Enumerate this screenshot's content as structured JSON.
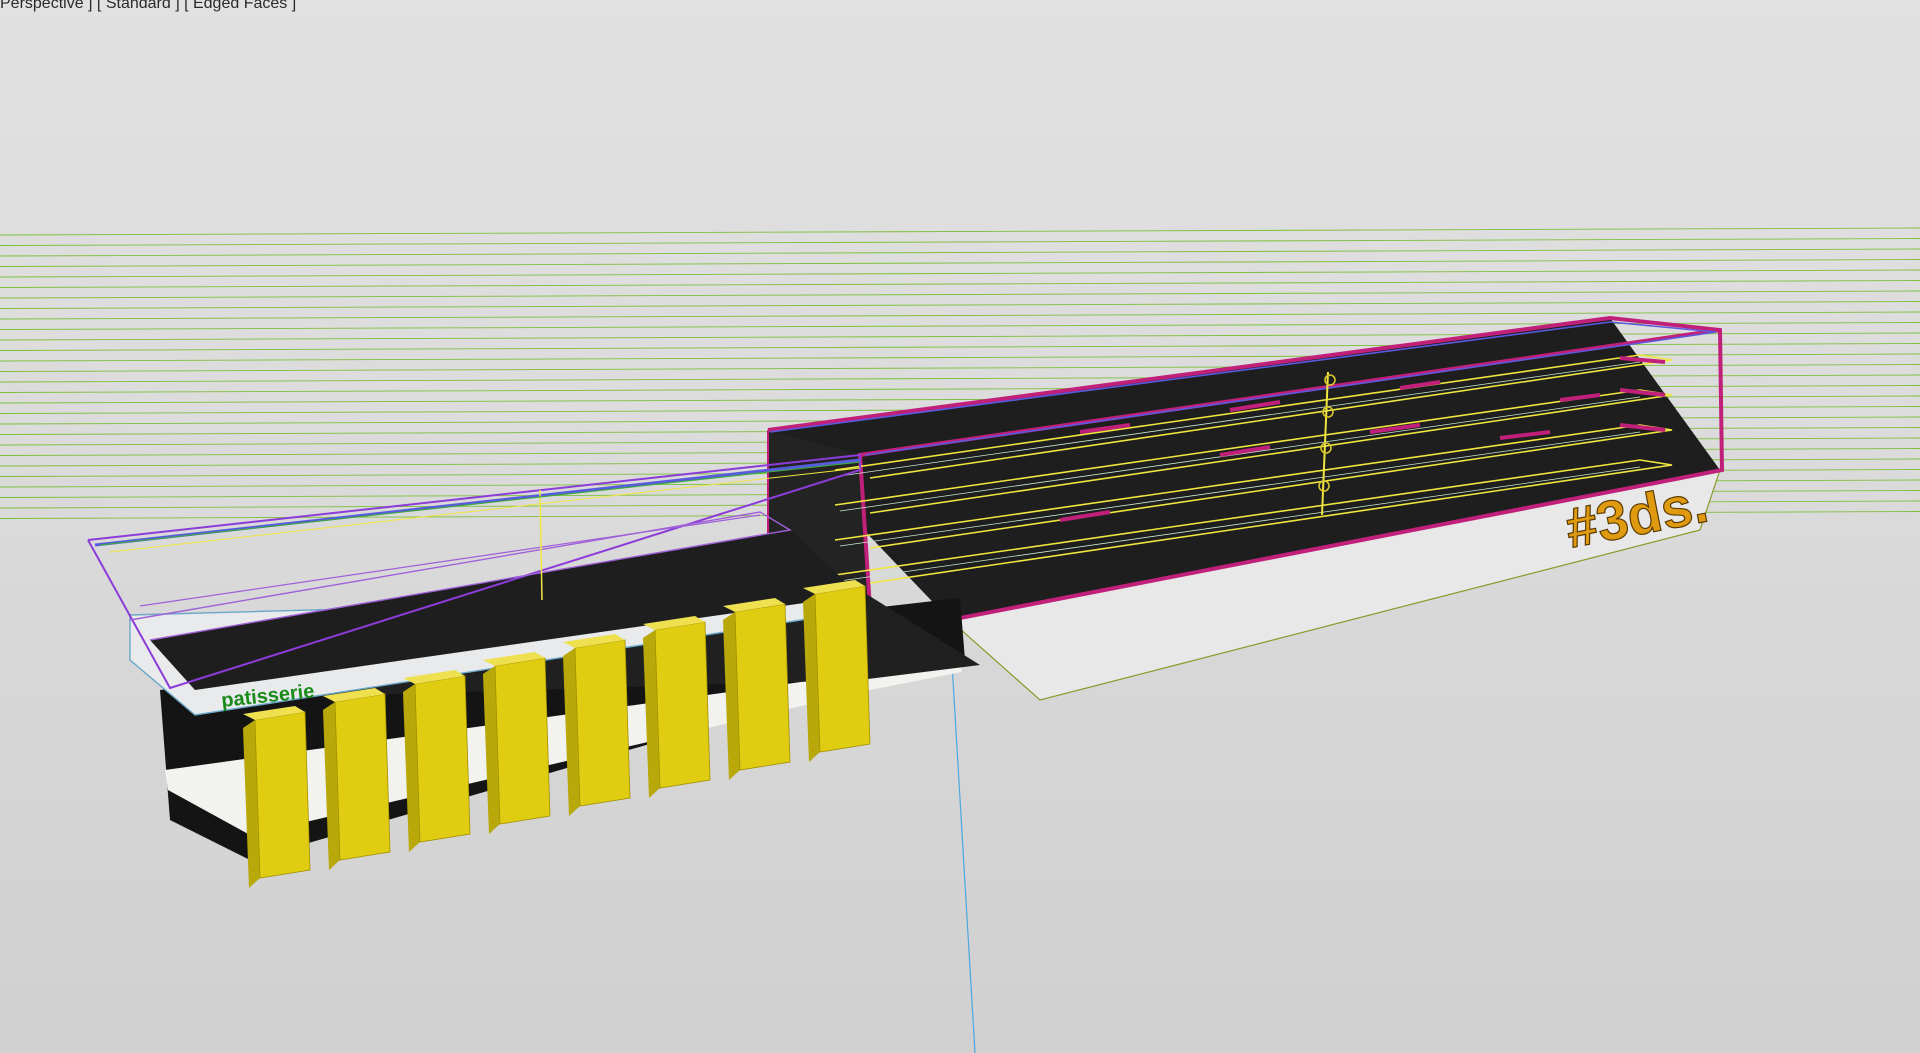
{
  "viewport": {
    "label": "Perspective ] [ Standard ] [ Edged Faces ]",
    "colors": {
      "background": "#dedede",
      "grid_lines": "#7cbf3a",
      "counter_body": "#1e1e1e",
      "counter_panel": "#e6e6e6",
      "legs": "#e0cd12",
      "outline_magenta": "#c0207a",
      "outline_purple": "#8c3cd8",
      "outline_blue": "#5a5ae0",
      "shelf_yellow": "#f0e640",
      "axis_blue": "#4aa8e0",
      "sign_text_orange": "#e09a10",
      "label_text_green": "#1a8a1a"
    }
  },
  "scene": {
    "counter_label": "patisserie",
    "display_sign": "#3ds.",
    "leg_count": 8,
    "shelf_count": 4
  }
}
